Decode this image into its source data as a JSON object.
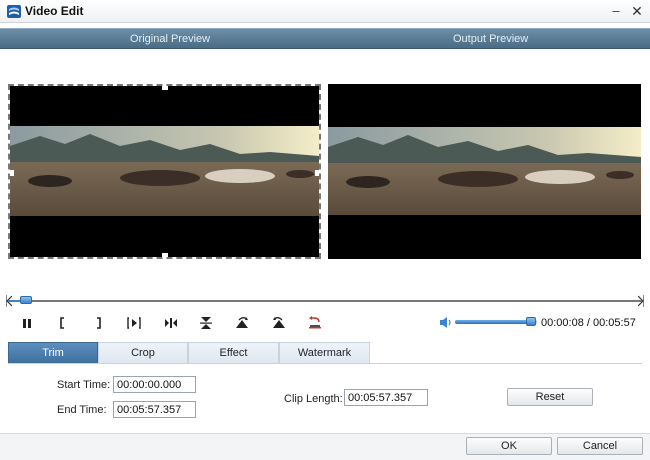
{
  "window": {
    "title": "Video Edit",
    "minimize_glyph": "–",
    "close_glyph": "✕"
  },
  "previews": {
    "original_label": "Original Preview",
    "output_label": "Output Preview"
  },
  "playback": {
    "position_fraction": 0.02,
    "current_time": "00:00:08",
    "separator": "/",
    "total_time": "00:05:57",
    "volume_fraction": 0.98
  },
  "controls": [
    {
      "name": "pause-button",
      "icon": "pause-icon"
    },
    {
      "name": "set-start-button",
      "icon": "bracket-left-icon"
    },
    {
      "name": "set-end-button",
      "icon": "bracket-right-icon"
    },
    {
      "name": "frame-step-button",
      "icon": "frame-step-icon"
    },
    {
      "name": "split-button",
      "icon": "split-icon"
    },
    {
      "name": "flip-vertical-button",
      "icon": "flip-vertical-icon"
    },
    {
      "name": "rotate-right-button",
      "icon": "rotate-right-icon"
    },
    {
      "name": "rotate-left-button",
      "icon": "rotate-left-icon"
    },
    {
      "name": "restore-button",
      "icon": "restore-icon"
    }
  ],
  "tabs": [
    {
      "label": "Trim",
      "active": true
    },
    {
      "label": "Crop",
      "active": false
    },
    {
      "label": "Effect",
      "active": false
    },
    {
      "label": "Watermark",
      "active": false
    }
  ],
  "trim": {
    "start_label": "Start Time:",
    "start_value": "00:00:00.000",
    "end_label": "End Time:",
    "end_value": "00:05:57.357",
    "clip_label": "Clip Length:",
    "clip_value": "00:05:57.357",
    "reset_label": "Reset"
  },
  "footer": {
    "ok_label": "OK",
    "cancel_label": "Cancel"
  },
  "colors": {
    "header_bar": "#4a6c86",
    "active_tab": "#3d6f9f",
    "slider_blue": "#3b82d0"
  }
}
